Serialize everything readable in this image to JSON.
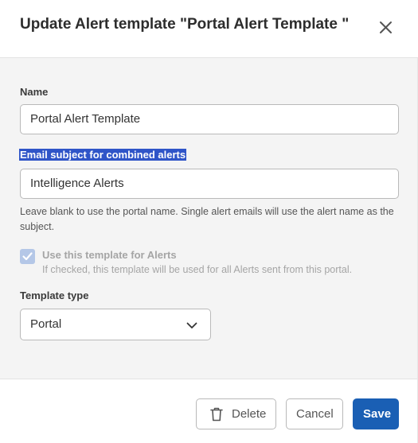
{
  "dialog": {
    "title": "Update Alert template \"Portal Alert Template \"",
    "close_icon": "close-icon"
  },
  "form": {
    "name": {
      "label": "Name",
      "value": "Portal Alert Template"
    },
    "email_subject": {
      "label": "Email subject for combined alerts",
      "value": "Intelligence Alerts",
      "help": "Leave blank to use the portal name. Single alert emails will use the alert name as the subject."
    },
    "use_template": {
      "label": "Use this template for Alerts",
      "help": "If checked, this template will be used for all Alerts sent from this portal.",
      "checked": true,
      "disabled": true
    },
    "template_type": {
      "label": "Template type",
      "selected": "Portal"
    }
  },
  "footer": {
    "delete_label": "Delete",
    "cancel_label": "Cancel",
    "save_label": "Save"
  },
  "colors": {
    "primary": "#1a5fb4",
    "highlight": "#2f55c8",
    "body_background": "#f4f4f4"
  }
}
